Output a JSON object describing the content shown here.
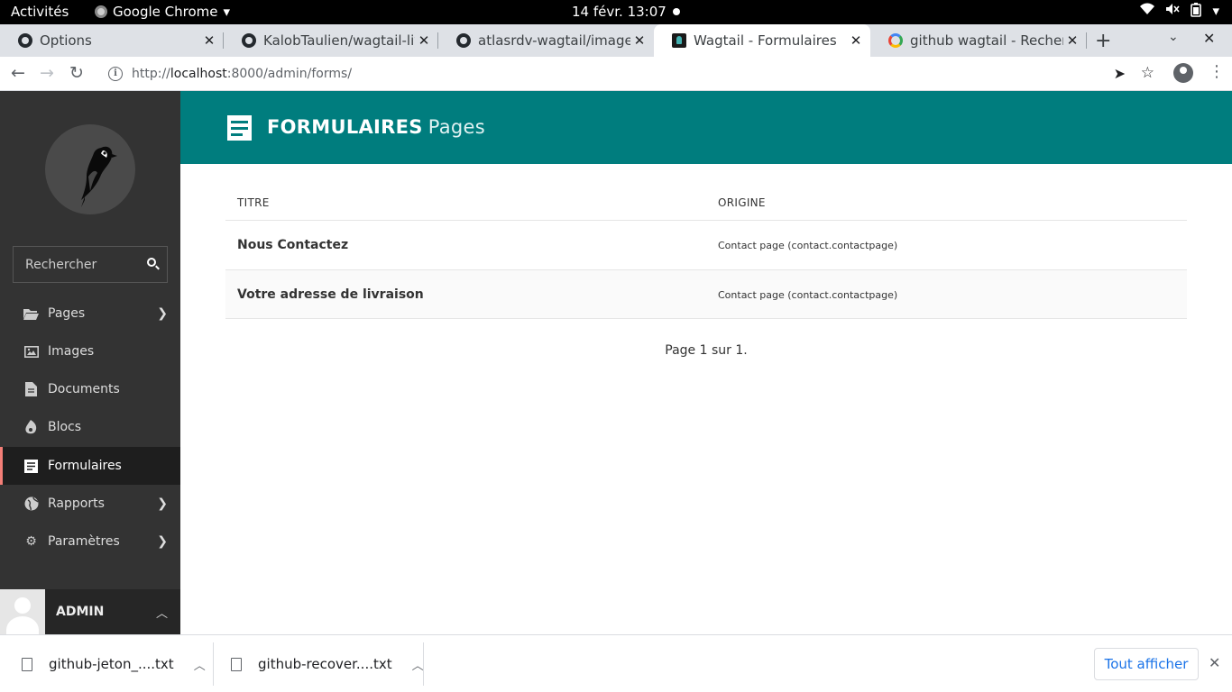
{
  "os": {
    "activities": "Activités",
    "app_name": "Google Chrome",
    "clock": "14 févr.  13:07"
  },
  "tabs": [
    {
      "label": "Options",
      "icon": "github-icon"
    },
    {
      "label": "KalobTaulien/wagtail-live",
      "icon": "github-icon"
    },
    {
      "label": "atlasrdv-wagtail/images a",
      "icon": "github-icon"
    },
    {
      "label": "Wagtail - Formulaires",
      "icon": "wagtail-icon",
      "active": true
    },
    {
      "label": "github wagtail - Recherch",
      "icon": "google-icon"
    }
  ],
  "address_bar": {
    "scheme": "http://",
    "host": "localhost",
    "path": ":8000/admin/forms/"
  },
  "sidebar": {
    "search_placeholder": "Rechercher",
    "items": [
      {
        "label": "Pages",
        "icon": "folder-open-icon",
        "has_submenu": true
      },
      {
        "label": "Images",
        "icon": "image-icon",
        "has_submenu": false
      },
      {
        "label": "Documents",
        "icon": "document-icon",
        "has_submenu": false
      },
      {
        "label": "Blocs",
        "icon": "snippet-icon",
        "has_submenu": false
      },
      {
        "label": "Formulaires",
        "icon": "form-icon",
        "has_submenu": false,
        "active": true
      },
      {
        "label": "Rapports",
        "icon": "globe-icon",
        "has_submenu": true
      },
      {
        "label": "Paramètres",
        "icon": "cogs-icon",
        "has_submenu": true
      }
    ],
    "account_name": "ADMIN"
  },
  "header": {
    "title": "FORMULAIRES",
    "subtitle": "Pages",
    "accent": "#007d7e"
  },
  "table": {
    "columns": [
      "TITRE",
      "ORIGINE"
    ],
    "rows": [
      {
        "title": "Nous Contactez",
        "origin": "Contact page (contact.contactpage)"
      },
      {
        "title": "Votre adresse de livraison",
        "origin": "Contact page (contact.contactpage)"
      }
    ]
  },
  "pagination": "Page 1 sur 1.",
  "downloads": {
    "files": [
      "github-jeton_....txt",
      "github-recover....txt"
    ],
    "show_all": "Tout afficher"
  }
}
